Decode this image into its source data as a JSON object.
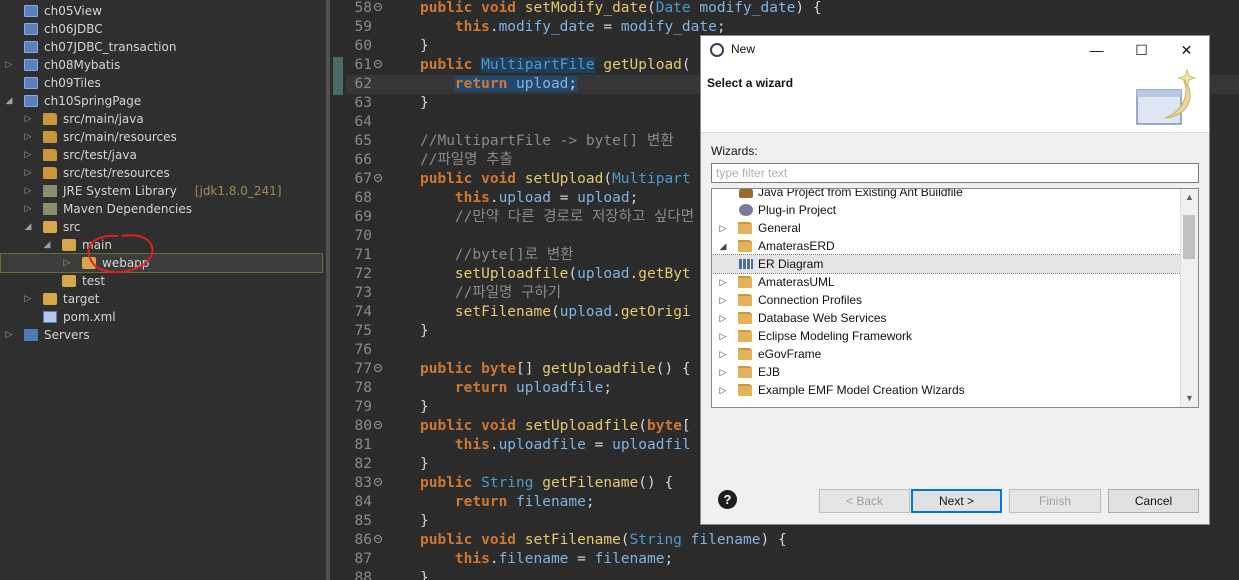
{
  "explorer": {
    "items": [
      {
        "label": "ch05View",
        "extra": "",
        "indent": 0,
        "arrow": "",
        "icon": "project",
        "selected": false
      },
      {
        "label": "ch06JDBC",
        "extra": "",
        "indent": 0,
        "arrow": "",
        "icon": "project",
        "selected": false
      },
      {
        "label": "ch07JDBC_transaction",
        "extra": "",
        "indent": 0,
        "arrow": "",
        "icon": "project",
        "selected": false
      },
      {
        "label": "ch08Mybatis",
        "extra": "",
        "indent": 0,
        "arrow": "collapsed",
        "icon": "project",
        "selected": false
      },
      {
        "label": "ch09Tiles",
        "extra": "",
        "indent": 0,
        "arrow": "",
        "icon": "project",
        "selected": false
      },
      {
        "label": "ch10SpringPage",
        "extra": "",
        "indent": 0,
        "arrow": "expanded",
        "icon": "project",
        "selected": false
      },
      {
        "label": "src/main/java",
        "extra": "",
        "indent": 1,
        "arrow": "collapsed",
        "icon": "package",
        "selected": false
      },
      {
        "label": "src/main/resources",
        "extra": "",
        "indent": 1,
        "arrow": "collapsed",
        "icon": "package",
        "selected": false
      },
      {
        "label": "src/test/java",
        "extra": "",
        "indent": 1,
        "arrow": "collapsed",
        "icon": "package",
        "selected": false
      },
      {
        "label": "src/test/resources",
        "extra": "",
        "indent": 1,
        "arrow": "collapsed",
        "icon": "package",
        "selected": false
      },
      {
        "label": "JRE System Library",
        "extra": "[jdk1.8.0_241]",
        "indent": 1,
        "arrow": "collapsed",
        "icon": "library",
        "selected": false
      },
      {
        "label": "Maven Dependencies",
        "extra": "",
        "indent": 1,
        "arrow": "collapsed",
        "icon": "library",
        "selected": false
      },
      {
        "label": "src",
        "extra": "",
        "indent": 1,
        "arrow": "expanded",
        "icon": "folder",
        "selected": false
      },
      {
        "label": "main",
        "extra": "",
        "indent": 2,
        "arrow": "expanded",
        "icon": "folder",
        "selected": false
      },
      {
        "label": "webapp",
        "extra": "",
        "indent": 3,
        "arrow": "collapsed",
        "icon": "folder",
        "selected": true
      },
      {
        "label": "test",
        "extra": "",
        "indent": 2,
        "arrow": "",
        "icon": "folder",
        "selected": false
      },
      {
        "label": "target",
        "extra": "",
        "indent": 1,
        "arrow": "collapsed",
        "icon": "folder",
        "selected": false
      },
      {
        "label": "pom.xml",
        "extra": "",
        "indent": 1,
        "arrow": "",
        "icon": "xml",
        "selected": false
      },
      {
        "label": "Servers",
        "extra": "",
        "indent": 0,
        "arrow": "collapsed",
        "icon": "server",
        "selected": false
      }
    ]
  },
  "editor": {
    "lines": [
      {
        "n": "58",
        "fold": true,
        "current": false,
        "tokens": [
          [
            "kw",
            "public "
          ],
          [
            "kw",
            "void "
          ],
          [
            "fn",
            "setModify_date"
          ],
          [
            "pl",
            "("
          ],
          [
            "ty",
            "Date "
          ],
          [
            "va",
            "modify_date"
          ],
          [
            "pl",
            ") {"
          ]
        ]
      },
      {
        "n": "59",
        "fold": false,
        "current": false,
        "tokens": [
          [
            "pl",
            "    "
          ],
          [
            "kw",
            "this"
          ],
          [
            "pl",
            "."
          ],
          [
            "va",
            "modify_date"
          ],
          [
            "pl",
            " = "
          ],
          [
            "va",
            "modify_date"
          ],
          [
            "pl",
            ";"
          ]
        ]
      },
      {
        "n": "60",
        "fold": false,
        "current": false,
        "tokens": [
          [
            "pl",
            "}"
          ]
        ]
      },
      {
        "n": "61",
        "fold": true,
        "current": false,
        "tokens": [
          [
            "kw",
            "public "
          ],
          [
            "ty hl2",
            "MultipartFile"
          ],
          [
            "pl",
            " "
          ],
          [
            "fn",
            "getUpload"
          ],
          [
            "pl",
            "("
          ]
        ]
      },
      {
        "n": "62",
        "fold": false,
        "current": true,
        "tokens": [
          [
            "pl",
            "    "
          ],
          [
            "kw hl",
            "return "
          ],
          [
            "va hl",
            "upload"
          ],
          [
            "pl hl",
            ";"
          ]
        ]
      },
      {
        "n": "63",
        "fold": false,
        "current": false,
        "tokens": [
          [
            "pl",
            "}"
          ]
        ]
      },
      {
        "n": "64",
        "fold": false,
        "current": false,
        "tokens": []
      },
      {
        "n": "65",
        "fold": false,
        "current": false,
        "tokens": [
          [
            "cm",
            "//MultipartFile -> byte[] 변환"
          ]
        ]
      },
      {
        "n": "66",
        "fold": false,
        "current": false,
        "tokens": [
          [
            "cm",
            "//파일명 추출"
          ]
        ]
      },
      {
        "n": "67",
        "fold": true,
        "current": false,
        "tokens": [
          [
            "kw",
            "public "
          ],
          [
            "kw",
            "void "
          ],
          [
            "fn",
            "setUpload"
          ],
          [
            "pl",
            "("
          ],
          [
            "ty",
            "Multipart"
          ]
        ]
      },
      {
        "n": "68",
        "fold": false,
        "current": false,
        "tokens": [
          [
            "pl",
            "    "
          ],
          [
            "kw",
            "this"
          ],
          [
            "pl",
            "."
          ],
          [
            "va",
            "upload"
          ],
          [
            "pl",
            " = "
          ],
          [
            "va",
            "upload"
          ],
          [
            "pl",
            ";"
          ]
        ]
      },
      {
        "n": "69",
        "fold": false,
        "current": false,
        "tokens": [
          [
            "pl",
            "    "
          ],
          [
            "cm",
            "//만약 다른 경로로 저장하고 싶다면 uplo"
          ]
        ]
      },
      {
        "n": "70",
        "fold": false,
        "current": false,
        "tokens": []
      },
      {
        "n": "71",
        "fold": false,
        "current": false,
        "tokens": [
          [
            "pl",
            "    "
          ],
          [
            "cm",
            "//byte[]로 변환"
          ]
        ]
      },
      {
        "n": "72",
        "fold": false,
        "current": false,
        "tokens": [
          [
            "pl",
            "    "
          ],
          [
            "fn",
            "setUploadfile"
          ],
          [
            "pl",
            "("
          ],
          [
            "va",
            "upload"
          ],
          [
            "pl",
            "."
          ],
          [
            "fn",
            "getByt"
          ]
        ]
      },
      {
        "n": "73",
        "fold": false,
        "current": false,
        "tokens": [
          [
            "pl",
            "    "
          ],
          [
            "cm",
            "//파일명 구하기"
          ]
        ]
      },
      {
        "n": "74",
        "fold": false,
        "current": false,
        "tokens": [
          [
            "pl",
            "    "
          ],
          [
            "fn",
            "setFilename"
          ],
          [
            "pl",
            "("
          ],
          [
            "va",
            "upload"
          ],
          [
            "pl",
            "."
          ],
          [
            "fn",
            "getOrigi"
          ]
        ]
      },
      {
        "n": "75",
        "fold": false,
        "current": false,
        "tokens": [
          [
            "pl",
            "}"
          ]
        ]
      },
      {
        "n": "76",
        "fold": false,
        "current": false,
        "tokens": []
      },
      {
        "n": "77",
        "fold": true,
        "current": false,
        "tokens": [
          [
            "kw",
            "public "
          ],
          [
            "kw",
            "byte"
          ],
          [
            "pl",
            "[] "
          ],
          [
            "fn",
            "getUploadfile"
          ],
          [
            "pl",
            "() {"
          ]
        ]
      },
      {
        "n": "78",
        "fold": false,
        "current": false,
        "tokens": [
          [
            "pl",
            "    "
          ],
          [
            "kw",
            "return "
          ],
          [
            "va",
            "uploadfile"
          ],
          [
            "pl",
            ";"
          ]
        ]
      },
      {
        "n": "79",
        "fold": false,
        "current": false,
        "tokens": [
          [
            "pl",
            "}"
          ]
        ]
      },
      {
        "n": "80",
        "fold": true,
        "current": false,
        "tokens": [
          [
            "kw",
            "public "
          ],
          [
            "kw",
            "void "
          ],
          [
            "fn",
            "setUploadfile"
          ],
          [
            "pl",
            "("
          ],
          [
            "kw",
            "byte"
          ],
          [
            "pl",
            "["
          ]
        ]
      },
      {
        "n": "81",
        "fold": false,
        "current": false,
        "tokens": [
          [
            "pl",
            "    "
          ],
          [
            "kw",
            "this"
          ],
          [
            "pl",
            "."
          ],
          [
            "va",
            "uploadfile"
          ],
          [
            "pl",
            " = "
          ],
          [
            "va",
            "uploadfil"
          ]
        ]
      },
      {
        "n": "82",
        "fold": false,
        "current": false,
        "tokens": [
          [
            "pl",
            "}"
          ]
        ]
      },
      {
        "n": "83",
        "fold": true,
        "current": false,
        "tokens": [
          [
            "kw",
            "public "
          ],
          [
            "ty",
            "String "
          ],
          [
            "fn",
            "getFilename"
          ],
          [
            "pl",
            "() {"
          ]
        ]
      },
      {
        "n": "84",
        "fold": false,
        "current": false,
        "tokens": [
          [
            "pl",
            "    "
          ],
          [
            "kw",
            "return "
          ],
          [
            "va",
            "filename"
          ],
          [
            "pl",
            ";"
          ]
        ]
      },
      {
        "n": "85",
        "fold": false,
        "current": false,
        "tokens": [
          [
            "pl",
            "}"
          ]
        ]
      },
      {
        "n": "86",
        "fold": true,
        "current": false,
        "tokens": [
          [
            "kw",
            "public "
          ],
          [
            "kw",
            "void "
          ],
          [
            "fn",
            "setFilename"
          ],
          [
            "pl",
            "("
          ],
          [
            "ty",
            "String "
          ],
          [
            "va",
            "filename"
          ],
          [
            "pl",
            ") {"
          ]
        ]
      },
      {
        "n": "87",
        "fold": false,
        "current": false,
        "tokens": [
          [
            "pl",
            "    "
          ],
          [
            "kw",
            "this"
          ],
          [
            "pl",
            "."
          ],
          [
            "va",
            "filename"
          ],
          [
            "pl",
            " = "
          ],
          [
            "va",
            "filename"
          ],
          [
            "pl",
            ";"
          ]
        ]
      },
      {
        "n": "88",
        "fold": false,
        "current": false,
        "tokens": [
          [
            "pl",
            "}"
          ]
        ]
      }
    ]
  },
  "dialog": {
    "title": "New",
    "minimize": "—",
    "maximize": "☐",
    "close": "✕",
    "header_title": "Select a wizard",
    "wizards_label": "Wizards:",
    "filter_placeholder": "type filter text",
    "items": [
      {
        "label": "Java Project from Existing Ant Buildfile",
        "indent": 1,
        "arrow": "",
        "icon": "ant",
        "selected": false
      },
      {
        "label": "Plug-in Project",
        "indent": 1,
        "arrow": "",
        "icon": "gear",
        "selected": false
      },
      {
        "label": "General",
        "indent": 0,
        "arrow": "collapsed",
        "icon": "folder",
        "selected": false
      },
      {
        "label": "AmaterasERD",
        "indent": 0,
        "arrow": "expanded",
        "icon": "folder",
        "selected": false
      },
      {
        "label": "ER Diagram",
        "indent": 1,
        "arrow": "",
        "icon": "grid",
        "selected": true
      },
      {
        "label": "AmaterasUML",
        "indent": 0,
        "arrow": "collapsed",
        "icon": "folder",
        "selected": false
      },
      {
        "label": "Connection Profiles",
        "indent": 0,
        "arrow": "collapsed",
        "icon": "folder",
        "selected": false
      },
      {
        "label": "Database Web Services",
        "indent": 0,
        "arrow": "collapsed",
        "icon": "folder",
        "selected": false
      },
      {
        "label": "Eclipse Modeling Framework",
        "indent": 0,
        "arrow": "collapsed",
        "icon": "folder",
        "selected": false
      },
      {
        "label": "eGovFrame",
        "indent": 0,
        "arrow": "collapsed",
        "icon": "folder",
        "selected": false
      },
      {
        "label": "EJB",
        "indent": 0,
        "arrow": "collapsed",
        "icon": "folder",
        "selected": false
      },
      {
        "label": "Example EMF Model Creation Wizards",
        "indent": 0,
        "arrow": "collapsed",
        "icon": "folder",
        "selected": false
      }
    ],
    "help": "?",
    "buttons": {
      "back": "< Back",
      "next": "Next >",
      "finish": "Finish",
      "cancel": "Cancel"
    }
  },
  "colors": {
    "annotation": "#e0201a",
    "accent": "#0078d7"
  }
}
